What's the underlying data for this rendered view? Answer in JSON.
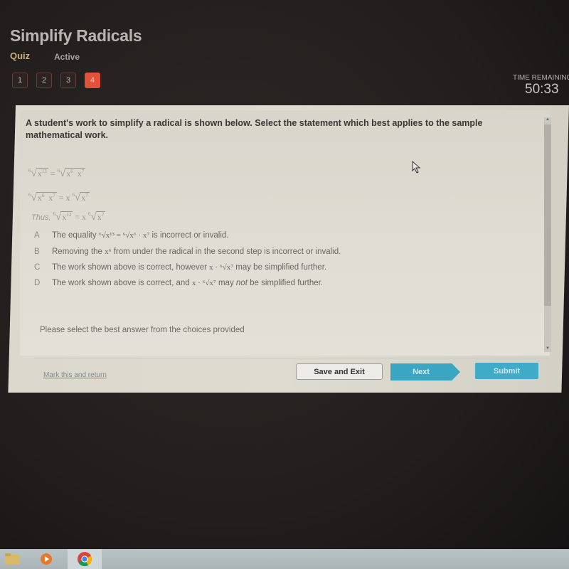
{
  "header": {
    "title": "Simplify Radicals",
    "type_label": "Quiz",
    "status_label": "Active",
    "question_numbers": [
      "1",
      "2",
      "3",
      "4"
    ],
    "current_question": "4",
    "time_remaining_label": "TIME REMAINING",
    "time_remaining_value": "50:33"
  },
  "question": {
    "prompt": "A student's work to simplify a radical is shown below. Select the statement which best applies to the sample mathematical work.",
    "work": {
      "line1": {
        "lhs_index": "6",
        "lhs_radicand": "x",
        "lhs_exp": "13",
        "eq": "=",
        "rhs_index": "6",
        "rhs_a": "x",
        "rhs_a_exp": "6",
        "rhs_b": "x",
        "rhs_b_exp": "7"
      },
      "line2": {
        "lhs_index": "6",
        "lhs_a": "x",
        "lhs_a_exp": "6",
        "lhs_b": "x",
        "lhs_b_exp": "7",
        "eq": "= x",
        "rhs_index": "6",
        "rhs_radicand": "x",
        "rhs_exp": "7"
      },
      "line3": {
        "prefix": "Thus,",
        "lhs_index": "6",
        "lhs_radicand": "x",
        "lhs_exp": "13",
        "eq": "= x",
        "rhs_index": "6",
        "rhs_radicand": "x",
        "rhs_exp": "7"
      }
    },
    "choices": [
      {
        "letter": "A",
        "text_before": "The equality",
        "math": "⁶√x¹³ = ⁶√x⁶ · x⁷",
        "text_after": "is incorrect or invalid."
      },
      {
        "letter": "B",
        "text_before": "Removing the",
        "math": "x⁶",
        "text_after": "from under the radical in the second step is incorrect or invalid."
      },
      {
        "letter": "C",
        "text_before": "The work shown above is correct, however",
        "math": "x · ⁶√x⁷",
        "text_after": "may be simplified further."
      },
      {
        "letter": "D",
        "text_before": "The work shown above is correct, and",
        "math": "x · ⁶√x⁷",
        "text_after_1": "may",
        "text_after_em": "not",
        "text_after_2": "be simplified further."
      }
    ],
    "hint": "Please select the best answer from the choices provided"
  },
  "footer": {
    "mark_link": "Mark this and return",
    "save_exit": "Save and Exit",
    "next": "Next",
    "submit": "Submit"
  },
  "taskbar": {
    "items": [
      "file-explorer",
      "media-player",
      "chrome"
    ]
  }
}
